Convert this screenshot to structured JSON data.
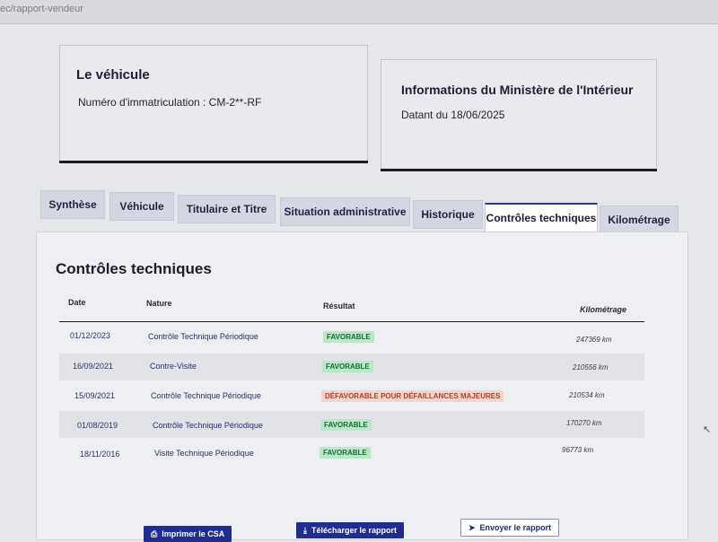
{
  "browser": {
    "url_text": "ec/rapport-vendeur"
  },
  "vehicle_card": {
    "title": "Le véhicule",
    "registration": "Numéro d'immatriculation : CM-2**-RF"
  },
  "ministry_card": {
    "title": "Informations du Ministère de l'Intérieur",
    "date": "Datant du 18/06/2025"
  },
  "tabs": [
    {
      "label": "Synthèse"
    },
    {
      "label": "Véhicule"
    },
    {
      "label": "Titulaire et Titre"
    },
    {
      "label": "Situation administrative"
    },
    {
      "label": "Historique"
    },
    {
      "label": "Contrôles techniques"
    },
    {
      "label": "Kilométrage"
    }
  ],
  "active_tab": "Contrôles techniques",
  "section": {
    "title": "Contrôles techniques"
  },
  "table": {
    "headers": [
      "Date",
      "Nature",
      "Résultat",
      "Kilométrage"
    ],
    "rows": [
      {
        "date": "01/12/2023",
        "nature": "Contrôle Technique Périodique",
        "result": "FAVORABLE",
        "km": "247369 km"
      },
      {
        "date": "16/09/2021",
        "nature": "Contre-Visite",
        "result": "FAVORABLE",
        "km": "210556 km"
      },
      {
        "date": "15/09/2021",
        "nature": "Contrôle Technique Périodique",
        "result": "DÉFAVORABLE POUR DÉFAILLANCES MAJEURES",
        "km": "210534 km"
      },
      {
        "date": "01/08/2019",
        "nature": "Contrôle Technique Périodique",
        "result": "FAVORABLE",
        "km": "170270 km"
      },
      {
        "date": "18/11/2016",
        "nature": "Visite Technique Périodique",
        "result": "FAVORABLE",
        "km": "96773 km"
      }
    ]
  },
  "actions": {
    "print_label": "Imprimer le CSA",
    "download_label": "Télécharger le rapport",
    "send_label": "Envoyer le rapport"
  },
  "colors": {
    "primary": "#1f2d8c",
    "success_bg": "#b9e8c8",
    "success_text": "#1d6a3a",
    "danger_bg": "#f3d5cc",
    "danger_text": "#b1412b"
  }
}
